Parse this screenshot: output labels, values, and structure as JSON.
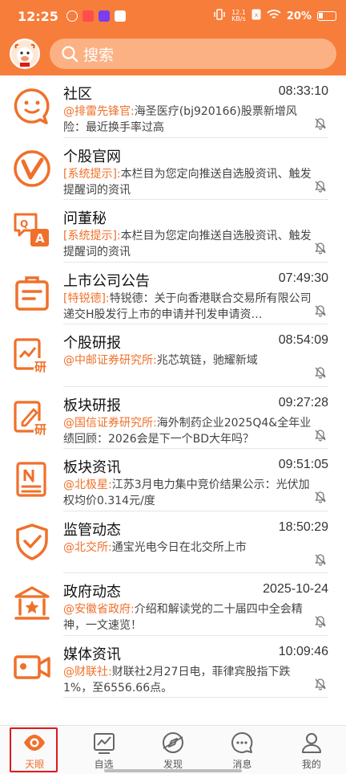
{
  "statusbar": {
    "time": "12:25",
    "net_speed_top": "12.1",
    "net_speed_unit": "KB/s",
    "battery": "20%"
  },
  "header": {
    "search_placeholder": "搜索"
  },
  "feed": [
    {
      "title": "社区",
      "time": "08:33:10",
      "source": "@排雷先锋官:",
      "text": "海圣医疗(bj920166)股票新增风险：最近换手率过高",
      "icon": "chat-bubble-icon"
    },
    {
      "title": "个股官网",
      "time": "",
      "source": "[系统提示]:",
      "text": "本栏目为您定向推送自选股资讯、触发提醒词的资讯",
      "icon": "verified-v-icon"
    },
    {
      "title": "问董秘",
      "time": "",
      "source": "[系统提示]:",
      "text": "本栏目为您定向推送自选股资讯、触发提醒词的资讯",
      "icon": "qa-icon"
    },
    {
      "title": "上市公司公告",
      "time": "07:49:30",
      "source": "[特锐德]:",
      "text": "特锐德：关于向香港联合交易所有限公司递交H股发行上市的申请并刊发申请资…",
      "icon": "announcement-icon"
    },
    {
      "title": "个股研报",
      "time": "08:54:09",
      "source": "@中邮证券研究所:",
      "text": "兆芯筑链，驰耀新域",
      "icon": "stock-research-icon"
    },
    {
      "title": "板块研报",
      "time": "09:27:28",
      "source": "@国信证券研究所:",
      "text": "海外制药企业2025Q4&全年业绩回顾：2026会是下一个BD大年吗？",
      "icon": "sector-research-icon"
    },
    {
      "title": "板块资讯",
      "time": "09:51:05",
      "source": "@北极星:",
      "text": "江苏3月电力集中竞价结果公示：光伏加权均价0.314元/度",
      "icon": "news-icon"
    },
    {
      "title": "监管动态",
      "time": "18:50:29",
      "source": "@北交所:",
      "text": "通宝光电今日在北交所上市",
      "icon": "shield-check-icon"
    },
    {
      "title": "政府动态",
      "time": "2025-10-24",
      "source": "@安徽省政府:",
      "text": "介绍和解读党的二十届四中全会精神，一文速览！",
      "icon": "government-building-icon"
    },
    {
      "title": "媒体资讯",
      "time": "10:09:46",
      "source": "@财联社:",
      "text": "财联社2月27日电，菲律宾股指下跌1%，至6556.66点。",
      "icon": "video-camera-icon"
    }
  ],
  "bottomnav": [
    {
      "label": "天眼",
      "icon": "eye-icon",
      "active": true
    },
    {
      "label": "自选",
      "icon": "chart-icon",
      "active": false
    },
    {
      "label": "发现",
      "icon": "compass-icon",
      "active": false
    },
    {
      "label": "消息",
      "icon": "message-icon",
      "active": false
    },
    {
      "label": "我的",
      "icon": "user-icon",
      "active": false
    }
  ],
  "colors": {
    "accent": "#f77d3a",
    "source_text": "#f0702a",
    "active_outline": "#e0181c"
  }
}
